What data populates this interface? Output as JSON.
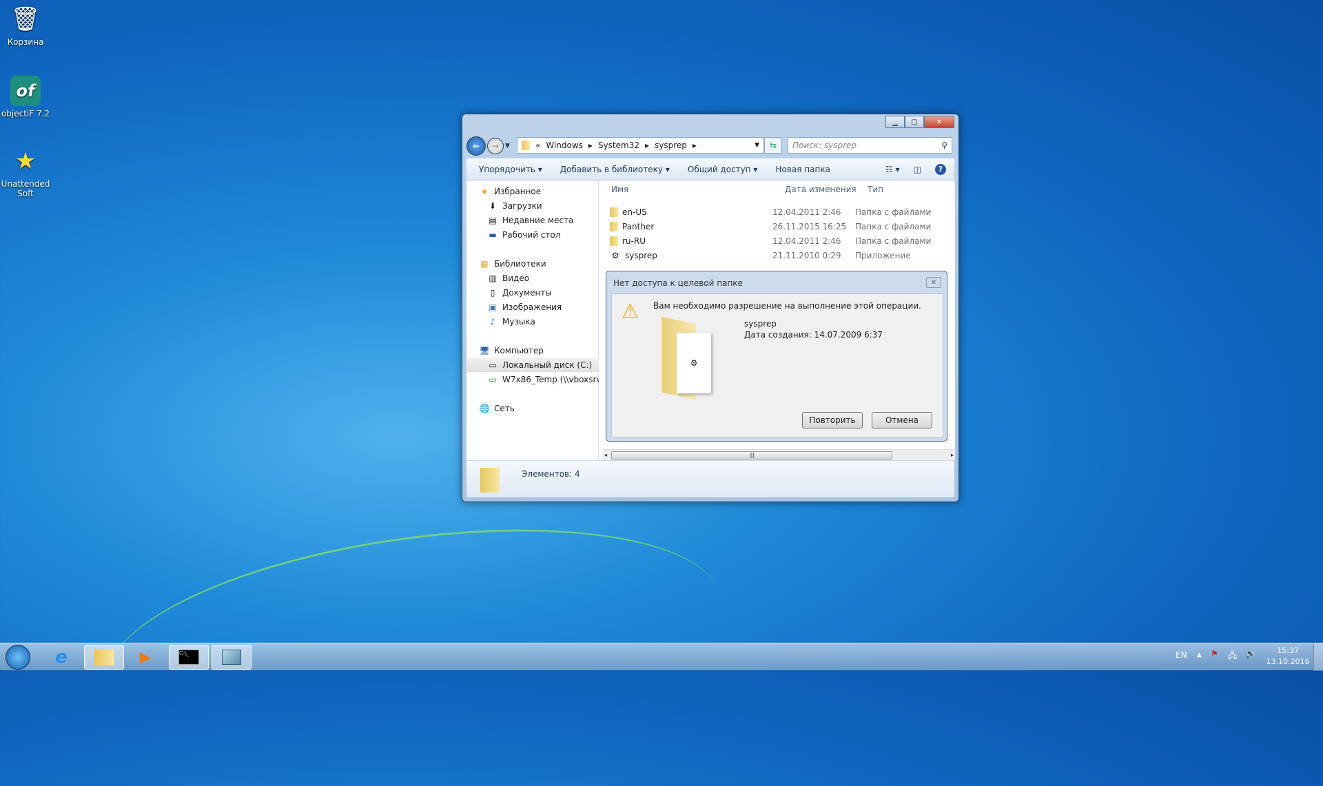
{
  "desktop": {
    "icons": [
      {
        "label": "Корзина",
        "icon": "recycle-bin-icon"
      },
      {
        "label": "objectiF 7.2",
        "icon": "objectif-icon"
      },
      {
        "label": "Unattended Soft",
        "icon": "star-icon"
      }
    ]
  },
  "explorer": {
    "breadcrumb": [
      "«",
      "Windows",
      "System32",
      "sysprep"
    ],
    "search_placeholder": "Поиск: sysprep",
    "toolbar": {
      "organize": "Упорядочить",
      "add_library": "Добавить в библиотеку",
      "share": "Общий доступ",
      "new_folder": "Новая папка"
    },
    "nav": {
      "favorites": "Избранное",
      "downloads": "Загрузки",
      "recent": "Недавние места",
      "desktop": "Рабочий стол",
      "libraries": "Библиотеки",
      "video": "Видео",
      "documents": "Документы",
      "images": "Изображения",
      "music": "Музыка",
      "computer": "Компьютер",
      "local_disk": "Локальный диск (C:)",
      "share_drive": "W7x86_Temp (\\\\vboxsrv) (",
      "network": "Сеть"
    },
    "columns": {
      "name": "Имя",
      "date": "Дата изменения",
      "type": "Тип"
    },
    "files": [
      {
        "name": "en-US",
        "date": "12.04.2011 2:46",
        "type": "Папка с файлами"
      },
      {
        "name": "Panther",
        "date": "26.11.2015 16:25",
        "type": "Папка с файлами"
      },
      {
        "name": "ru-RU",
        "date": "12.04.2011 2:46",
        "type": "Папка с файлами"
      },
      {
        "name": "sysprep",
        "date": "21.11.2010 0:29",
        "type": "Приложение"
      }
    ],
    "status": "Элементов: 4"
  },
  "dialog": {
    "title": "Нет доступа к целевой папке",
    "message": "Вам необходимо разрешение на выполнение этой операции.",
    "item_name": "sysprep",
    "item_created": "Дата создания: 14.07.2009 6:37",
    "retry": "Повторить",
    "cancel": "Отмена"
  },
  "tray": {
    "lang": "EN",
    "time": "15:37",
    "date": "13.10.2016"
  }
}
